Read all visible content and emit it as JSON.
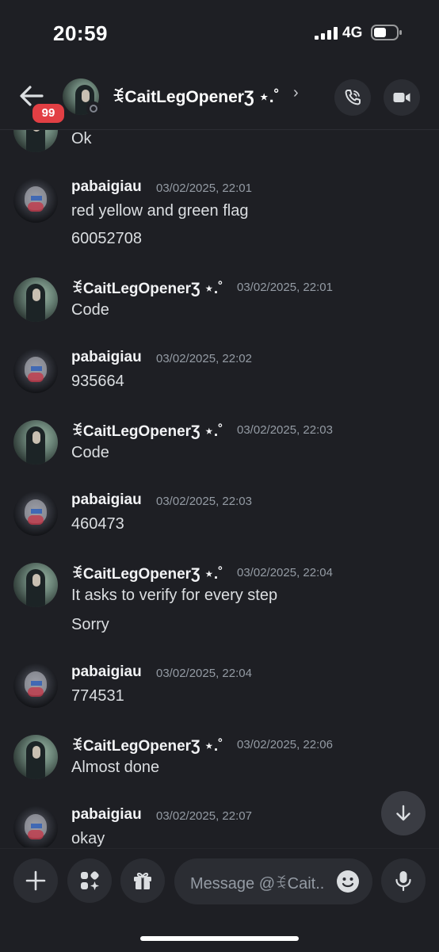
{
  "status_bar": {
    "time": "20:59",
    "network": "4G"
  },
  "header": {
    "unread_badge": "99",
    "display_name": "ꉂCaitLegOpenerƷ ⋆.˚",
    "chevron": "›"
  },
  "messages": [
    {
      "lines": [
        "Ok"
      ]
    },
    {
      "author": "pabaigiau",
      "timestamp": "03/02/2025, 22:01",
      "lines": [
        "red yellow and green flag",
        "60052708"
      ]
    },
    {
      "author": "ꉂCaitLegOpenerƷ ⋆.˚",
      "timestamp": "03/02/2025, 22:01",
      "lines": [
        "Code"
      ]
    },
    {
      "author": "pabaigiau",
      "timestamp": "03/02/2025, 22:02",
      "lines": [
        "935664"
      ]
    },
    {
      "author": "ꉂCaitLegOpenerƷ ⋆.˚",
      "timestamp": "03/02/2025, 22:03",
      "lines": [
        "Code"
      ]
    },
    {
      "author": "pabaigiau",
      "timestamp": "03/02/2025, 22:03",
      "lines": [
        "460473"
      ]
    },
    {
      "author": "ꉂCaitLegOpenerƷ ⋆.˚",
      "timestamp": "03/02/2025, 22:04",
      "lines": [
        "It asks to verify for every step",
        "Sorry"
      ]
    },
    {
      "author": "pabaigiau",
      "timestamp": "03/02/2025, 22:04",
      "lines": [
        "774531"
      ]
    },
    {
      "author": "ꉂCaitLegOpenerƷ ⋆.˚",
      "timestamp": "03/02/2025, 22:06",
      "lines": [
        "Almost done"
      ]
    },
    {
      "author": "pabaigiau",
      "timestamp": "03/02/2025, 22:07",
      "lines": [
        "okay"
      ]
    }
  ],
  "composer": {
    "placeholder": "Message @ꉂCait.."
  },
  "icons": {
    "back": "back-arrow-icon",
    "call": "phone-icon",
    "video": "video-camera-icon",
    "plus": "plus-icon",
    "apps": "apps-icon",
    "gift": "gift-icon",
    "emoji": "emoji-icon",
    "mic": "microphone-icon",
    "scroll": "arrow-down-icon"
  },
  "colors": {
    "background": "#1e1f24",
    "badge": "#e23f44",
    "button": "#2b2d33",
    "timestamp": "#949ba4"
  }
}
